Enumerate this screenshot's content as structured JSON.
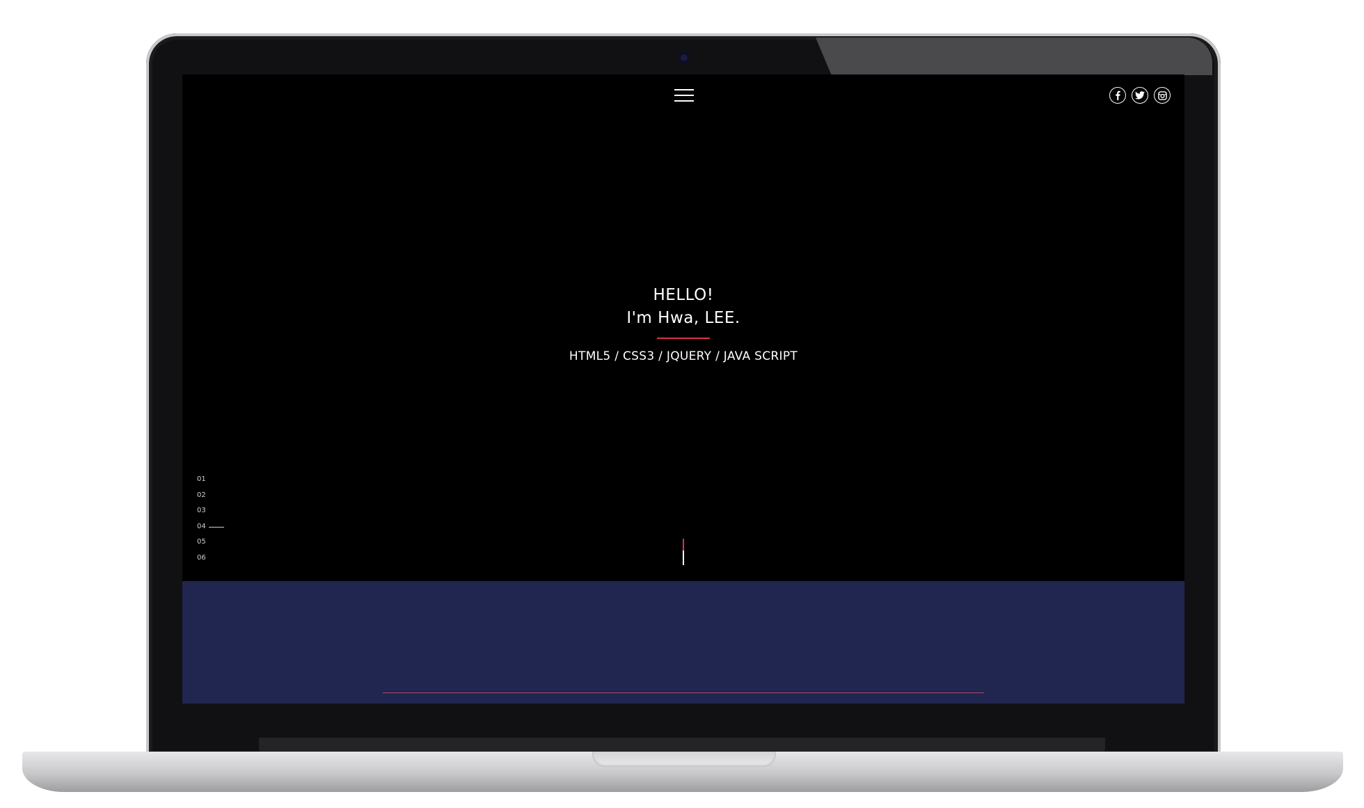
{
  "header": {
    "menu_icon": "hamburger-menu-icon",
    "social": [
      {
        "name": "facebook",
        "icon": "facebook-icon",
        "glyph": "f"
      },
      {
        "name": "twitter",
        "icon": "twitter-icon",
        "glyph": "t"
      },
      {
        "name": "instagram",
        "icon": "instagram-icon",
        "glyph": "i"
      }
    ]
  },
  "hero": {
    "line1": "HELLO!",
    "line2": "I'm Hwa, LEE.",
    "skills": "HTML5 / CSS3 / JQUERY / JAVA SCRIPT"
  },
  "page_nav": {
    "items": [
      "01",
      "02",
      "03",
      "04",
      "05",
      "06"
    ],
    "active": "04"
  },
  "colors": {
    "background": "#000000",
    "accent": "#e0304a",
    "next_section": "#20264f",
    "text": "#ffffff"
  }
}
